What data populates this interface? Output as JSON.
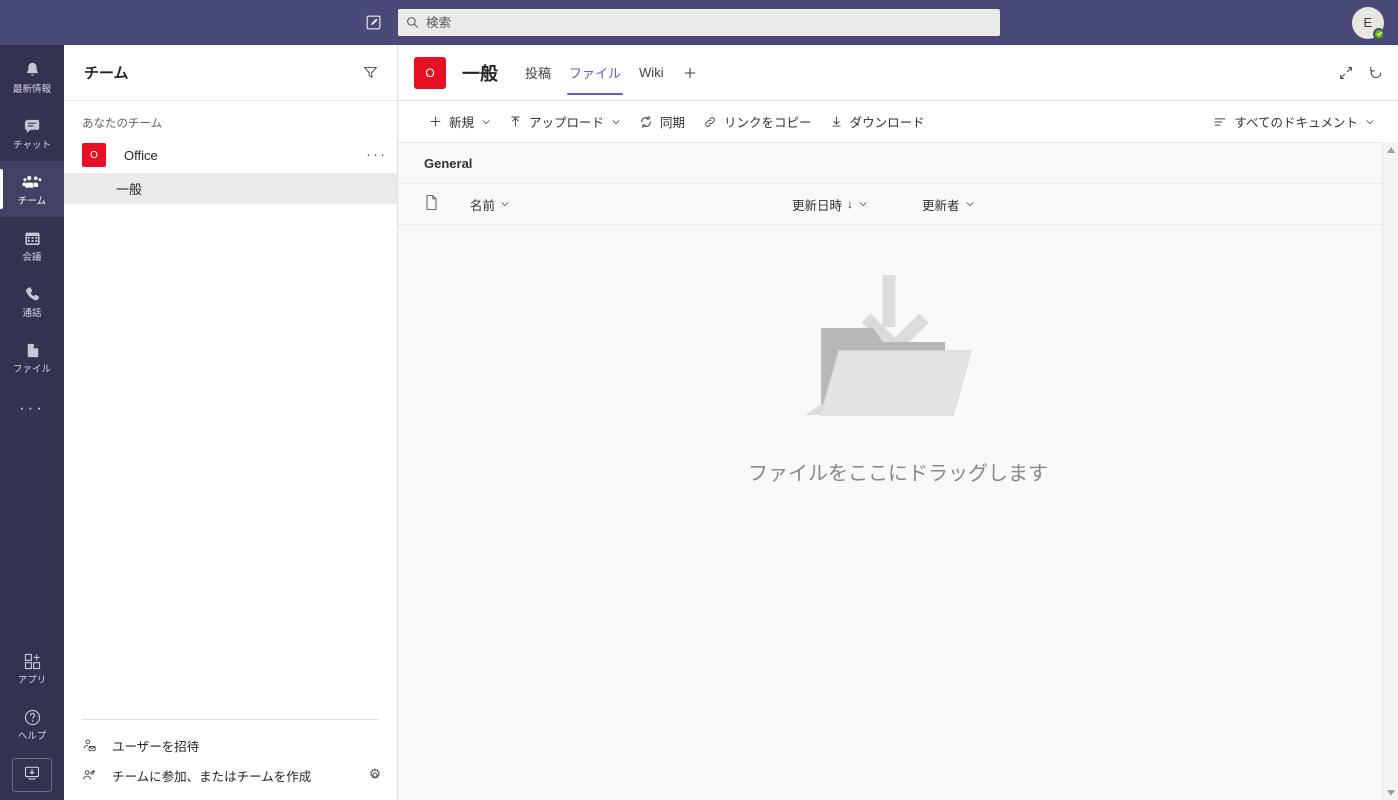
{
  "topbar": {
    "compose_icon": "compose-icon",
    "search": {
      "icon": "search-icon",
      "placeholder": "検索",
      "value": ""
    },
    "avatar": {
      "initials": "E",
      "presence": "available"
    }
  },
  "rail": {
    "items": [
      {
        "id": "activity",
        "label": "最新情報",
        "icon": "bell-icon",
        "active": false
      },
      {
        "id": "chat",
        "label": "チャット",
        "icon": "chat-icon",
        "active": false
      },
      {
        "id": "teams",
        "label": "チーム",
        "icon": "teams-icon",
        "active": true
      },
      {
        "id": "calendar",
        "label": "会議",
        "icon": "calendar-icon",
        "active": false
      },
      {
        "id": "calls",
        "label": "通話",
        "icon": "phone-icon",
        "active": false
      },
      {
        "id": "files",
        "label": "ファイル",
        "icon": "file-icon",
        "active": false
      }
    ],
    "more_label": "···",
    "bottom_items": [
      {
        "id": "apps",
        "label": "アプリ",
        "icon": "apps-icon"
      },
      {
        "id": "help",
        "label": "ヘルプ",
        "icon": "help-icon"
      }
    ],
    "download_icon": "download-desktop-icon"
  },
  "teams_panel": {
    "title": "チーム",
    "filter_icon": "filter-icon",
    "section_label": "あなたのチーム",
    "teams": [
      {
        "name": "Office",
        "avatar_letter": "O",
        "avatar_color": "#e81123",
        "more_label": "···",
        "channels": [
          {
            "name": "一般",
            "selected": true
          }
        ]
      }
    ],
    "footer": [
      {
        "id": "invite-people",
        "label": "ユーザーを招待",
        "icon": "person-add-icon"
      },
      {
        "id": "join-or-create-team",
        "label": "チームに参加、またはチームを作成",
        "icon": "people-add-icon"
      }
    ],
    "settings_icon": "gear-icon"
  },
  "channel": {
    "avatar_letter": "O",
    "avatar_color": "#e81123",
    "title": "一般",
    "tabs": [
      {
        "id": "posts",
        "label": "投稿",
        "active": false
      },
      {
        "id": "files",
        "label": "ファイル",
        "active": true
      },
      {
        "id": "wiki",
        "label": "Wiki",
        "active": false
      }
    ],
    "add_tab_label": "＋",
    "actions": [
      {
        "id": "expand",
        "icon": "expand-icon"
      },
      {
        "id": "refresh",
        "icon": "refresh-icon"
      }
    ]
  },
  "command_bar": {
    "commands": [
      {
        "id": "new",
        "label": "新規",
        "icon": "plus-icon",
        "has_caret": true
      },
      {
        "id": "upload",
        "label": "アップロード",
        "icon": "upload-icon",
        "has_caret": true
      },
      {
        "id": "sync",
        "label": "同期",
        "icon": "sync-icon",
        "has_caret": false
      },
      {
        "id": "copy-link",
        "label": "リンクをコピー",
        "icon": "link-icon",
        "has_caret": false
      },
      {
        "id": "download",
        "label": "ダウンロード",
        "icon": "download-icon",
        "has_caret": false
      }
    ],
    "view_selector": {
      "label": "すべてのドキュメント",
      "icon": "list-view-icon",
      "has_caret": true
    }
  },
  "files_view": {
    "breadcrumb": "General",
    "columns": [
      {
        "id": "type",
        "label": "",
        "icon": "document-icon",
        "sorted": false
      },
      {
        "id": "name",
        "label": "名前",
        "sorted": false
      },
      {
        "id": "modified",
        "label": "更新日時",
        "sorted": true,
        "sort_arrow": "↓"
      },
      {
        "id": "modified-by",
        "label": "更新者",
        "sorted": false
      }
    ],
    "rows": [],
    "empty_state": {
      "illustration": "drag-files-folder-illustration",
      "text": "ファイルをここにドラッグします"
    }
  },
  "colors": {
    "topbar": "#4a4a79",
    "rail": "#33334f",
    "rail_active": "#414164",
    "accent": "#5b5fc7",
    "team_avatar": "#e81123",
    "content_bg": "#faf9f8",
    "presence_available": "#6bb700"
  }
}
